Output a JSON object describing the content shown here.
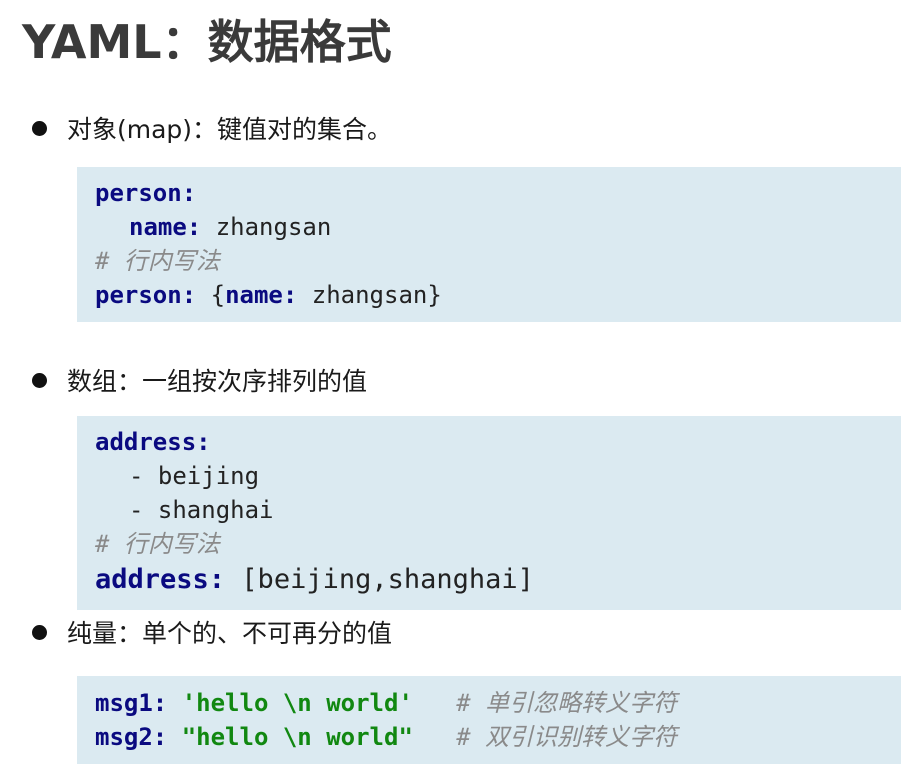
{
  "title": "YAML：数据格式",
  "sections": [
    {
      "bullet": "对象(map)：键值对的集合。",
      "code": {
        "line1_key": "person:",
        "line2_key": "name:",
        "line2_value": " zhangsan",
        "line3_comment": "# 行内写法",
        "line4_key": "person:",
        "line4_open": " {",
        "line4_inner_key": "name:",
        "line4_rest": " zhangsan}"
      }
    },
    {
      "bullet": "数组：一组按次序排列的值",
      "code": {
        "line1_key": "address:",
        "line2_value": "- beijing",
        "line3_value": "- shanghai",
        "line4_comment": "# 行内写法",
        "line5_key": "address:",
        "line5_value": " [beijing,shanghai]"
      }
    },
    {
      "bullet": "纯量：单个的、不可再分的值",
      "code": {
        "line1_key": "msg1:",
        "line1_value": "'hello \\n world'",
        "line1_comment": "# 单引忽略转义字符",
        "line2_key": "msg2:",
        "line2_value": "\"hello \\n world\"",
        "line2_comment": "# 双引识别转义字符"
      }
    }
  ]
}
